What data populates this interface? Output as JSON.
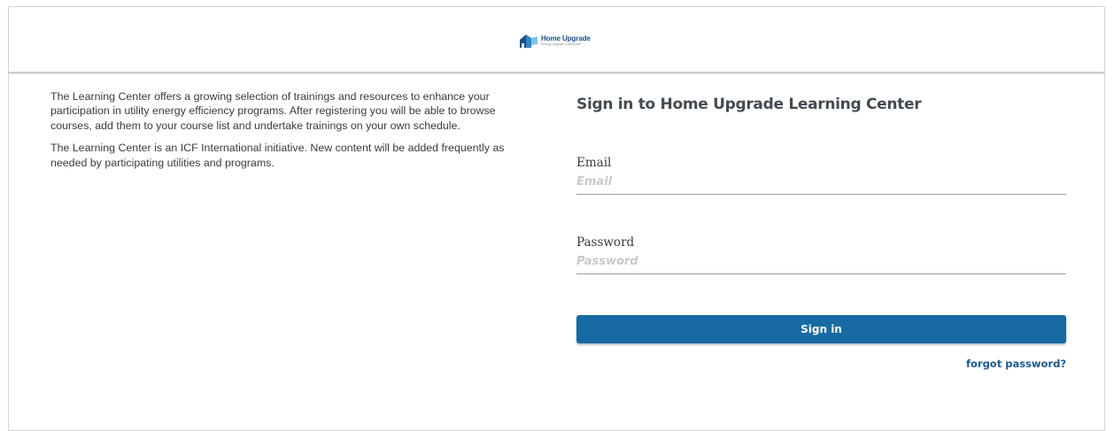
{
  "header": {
    "logo_title": "Home Upgrade",
    "logo_subtitle": "Energy Upgrade California®",
    "logo_icon": "house-icon",
    "brand_color": "#1d4f86"
  },
  "intro": {
    "paragraph1": "The Learning Center offers a growing selection of trainings and resources to enhance your participation in utility energy efficiency programs. After registering you will be able to browse courses, add them to your course list and undertake trainings on your own schedule.",
    "paragraph2": "The Learning Center is an ICF International initiative. New content will be added frequently as needed by participating utilities and programs."
  },
  "signin": {
    "title": "Sign in to Home Upgrade Learning Center",
    "email": {
      "label": "Email",
      "placeholder": "Email",
      "value": ""
    },
    "password": {
      "label": "Password",
      "placeholder": "Password",
      "value": ""
    },
    "submit_label": "Sign in",
    "forgot_label": "forgot password?",
    "button_color": "#176aa2"
  }
}
